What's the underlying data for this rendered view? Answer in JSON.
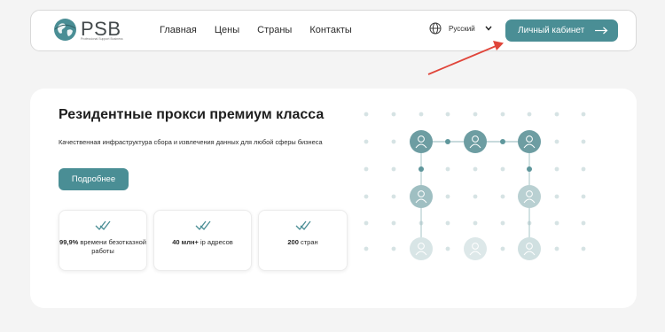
{
  "header": {
    "logo_text": "PSB",
    "logo_tagline": "Professional Support Business",
    "nav": [
      "Главная",
      "Цены",
      "Страны",
      "Контакты"
    ],
    "language": "Русский",
    "cabinet_button": "Личный кабинет",
    "icons": {
      "globe": "globe-icon",
      "chevron": "chevron-down-icon",
      "arrow": "arrow-right-icon"
    }
  },
  "hero": {
    "title": "Резидентные прокси премиум класса",
    "subtitle": "Качественная инфраструктура сбора и извлечения данных для любой сферы бизнеса",
    "more_button": "Подробнее",
    "stats": [
      {
        "bold": "99,9%",
        "rest": " времени безотказной работы"
      },
      {
        "bold": "40 млн+",
        "rest": " ip адресов"
      },
      {
        "bold": "200",
        "rest": " стран"
      }
    ]
  },
  "colors": {
    "accent": "#4a8e95",
    "annotation": "#e0453a"
  }
}
